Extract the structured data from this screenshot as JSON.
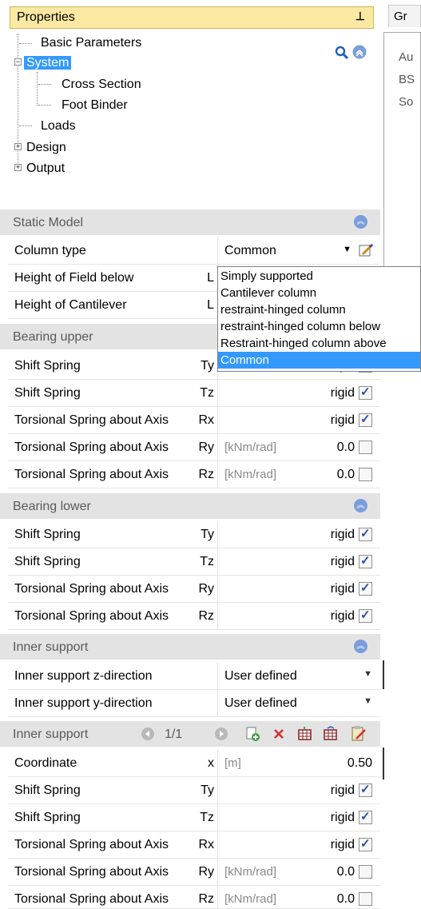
{
  "panel": {
    "title": "Properties",
    "pin": "ᵖ"
  },
  "tree": {
    "items": [
      {
        "label": "Basic Parameters"
      },
      {
        "label": "System"
      },
      {
        "label": "Cross Section"
      },
      {
        "label": "Foot Binder"
      },
      {
        "label": "Loads"
      },
      {
        "label": "Design"
      },
      {
        "label": "Output"
      }
    ],
    "tools": [
      "search-icon",
      "collapse-all-icon"
    ]
  },
  "static_model": {
    "title": "Static Model",
    "rows": [
      {
        "name": "Column type",
        "value": "Common"
      },
      {
        "name": "Height of Field below",
        "sym": "L"
      },
      {
        "name": "Height of Cantilever",
        "sym": "L"
      }
    ],
    "dropdown": {
      "options": [
        "Simply supported",
        "Cantilever column",
        "restraint-hinged column",
        "restraint-hinged column below",
        "Restraint-hinged column above",
        "Common"
      ],
      "selected": "Common"
    }
  },
  "bearing_upper": {
    "title": "Bearing upper",
    "rows": [
      {
        "name": "Shift Spring",
        "sym": "Ty",
        "value": "rigid",
        "checked": true
      },
      {
        "name": "Shift Spring",
        "sym": "Tz",
        "value": "rigid",
        "checked": true
      },
      {
        "name": "Torsional Spring about Axis",
        "sym": "Rx",
        "value": "rigid",
        "checked": true
      },
      {
        "name": "Torsional Spring about Axis",
        "sym": "Ry",
        "unit": "[kNm/rad]",
        "value": "0.0",
        "checked": false
      },
      {
        "name": "Torsional Spring about Axis",
        "sym": "Rz",
        "unit": "[kNm/rad]",
        "value": "0.0",
        "checked": false
      }
    ]
  },
  "bearing_lower": {
    "title": "Bearing lower",
    "rows": [
      {
        "name": "Shift Spring",
        "sym": "Ty",
        "value": "rigid",
        "checked": true
      },
      {
        "name": "Shift Spring",
        "sym": "Tz",
        "value": "rigid",
        "checked": true
      },
      {
        "name": "Torsional Spring about Axis",
        "sym": "Ry",
        "value": "rigid",
        "checked": true
      },
      {
        "name": "Torsional Spring about Axis",
        "sym": "Rz",
        "value": "rigid",
        "checked": true
      }
    ]
  },
  "inner_support": {
    "title": "Inner support",
    "rows": [
      {
        "name": "Inner support z-direction",
        "value": "User defined"
      },
      {
        "name": "Inner support y-direction",
        "value": "User defined"
      }
    ]
  },
  "inner_support_list": {
    "title": "Inner support",
    "pager": "1/1",
    "rows": [
      {
        "name": "Coordinate",
        "sym": "x",
        "unit": "[m]",
        "value": "0.50"
      },
      {
        "name": "Shift Spring",
        "sym": "Ty",
        "value": "rigid",
        "checked": true
      },
      {
        "name": "Shift Spring",
        "sym": "Tz",
        "value": "rigid",
        "checked": true
      },
      {
        "name": "Torsional Spring about Axis",
        "sym": "Rx",
        "value": "rigid",
        "checked": true
      },
      {
        "name": "Torsional Spring about Axis",
        "sym": "Ry",
        "unit": "[kNm/rad]",
        "value": "0.0",
        "checked": false
      },
      {
        "name": "Torsional Spring about Axis",
        "sym": "Rz",
        "unit": "[kNm/rad]",
        "value": "0.0",
        "checked": false
      }
    ]
  },
  "right_pane": {
    "tab": "Gr",
    "lines": [
      "Au",
      "BS",
      "So"
    ]
  }
}
